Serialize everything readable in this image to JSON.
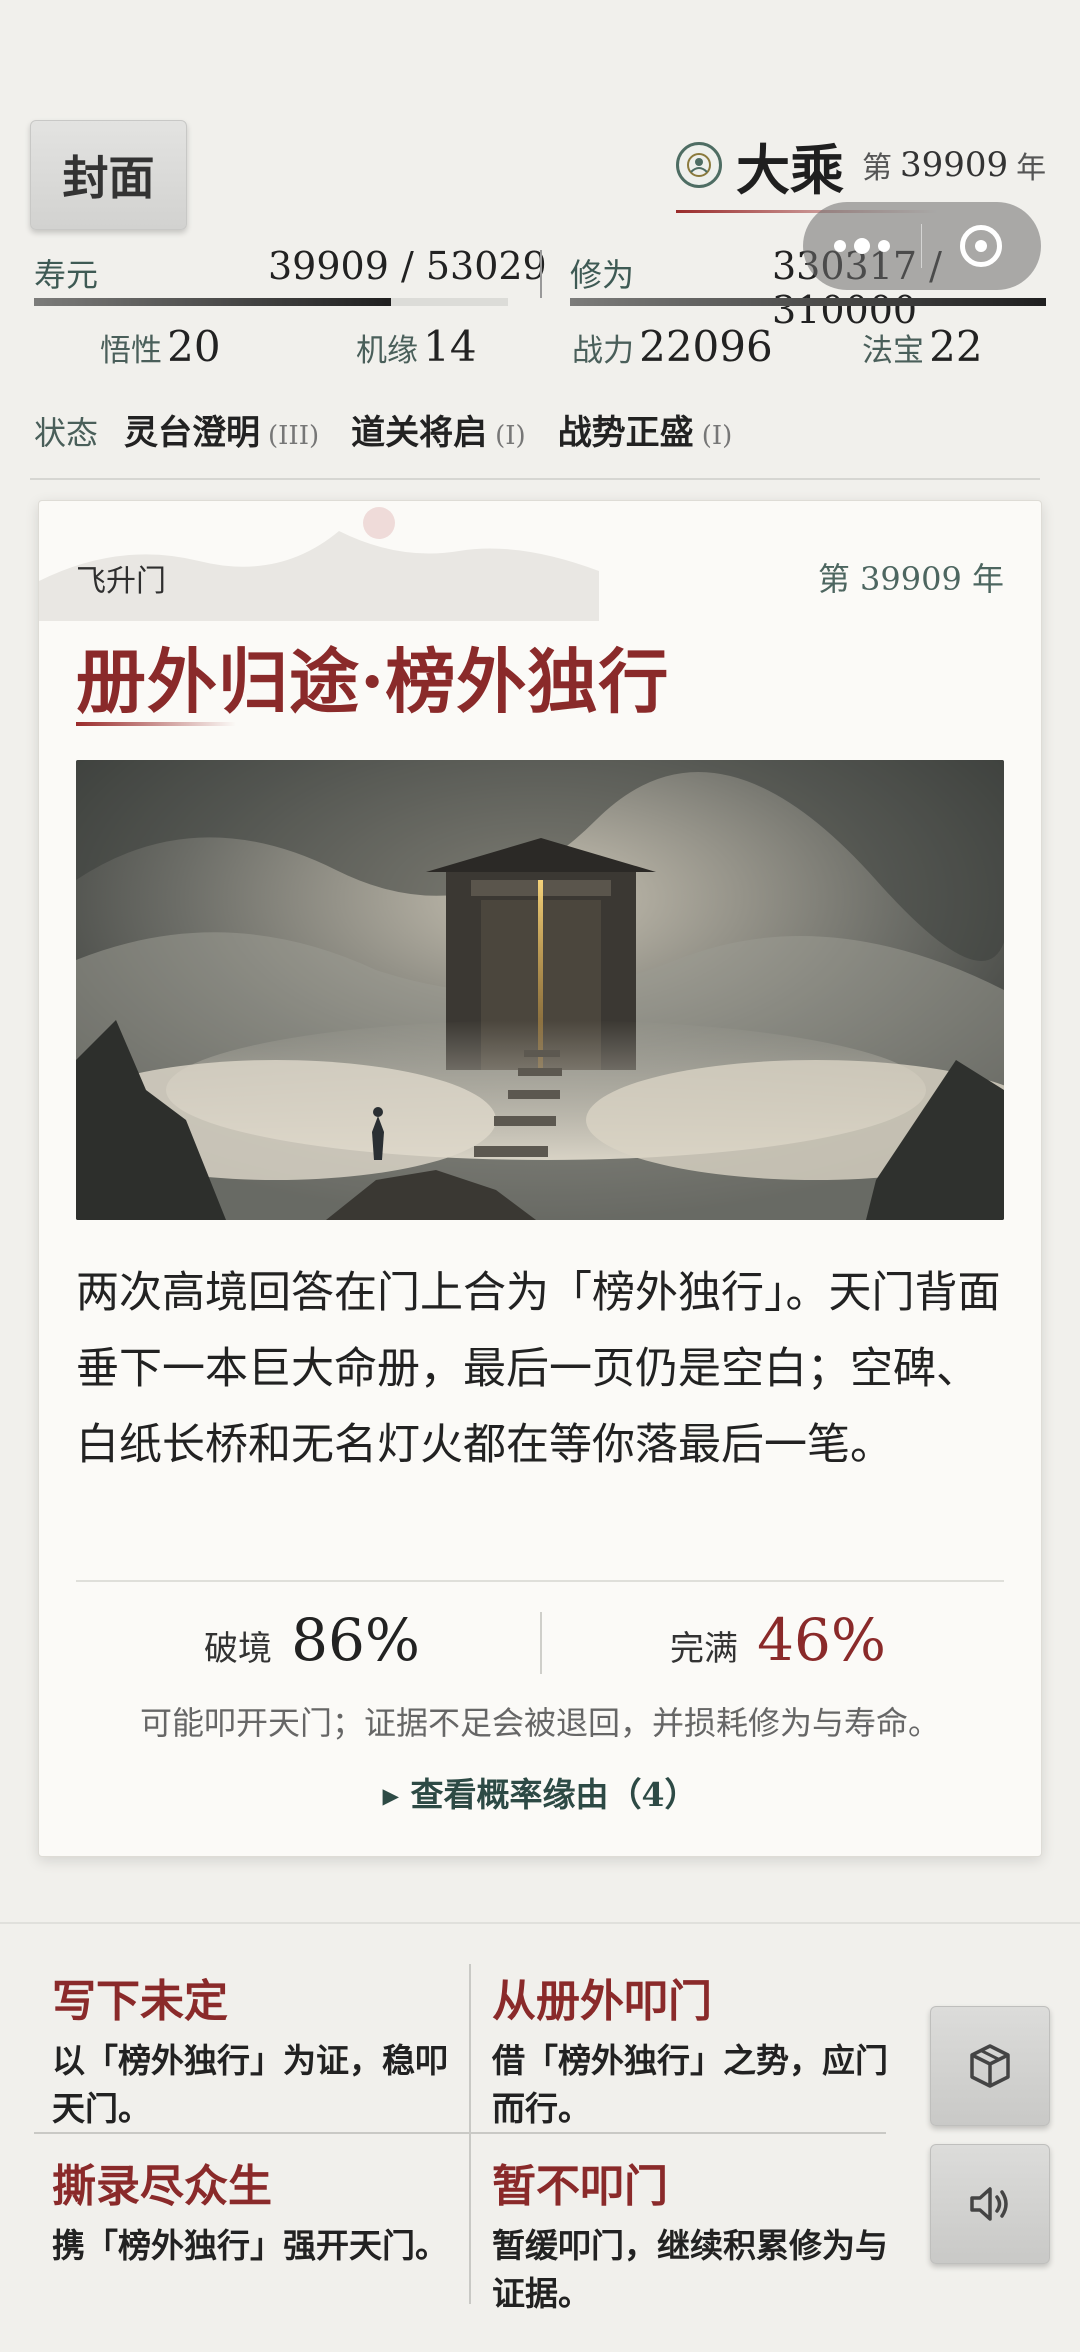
{
  "header": {
    "cover_label": "封面",
    "realm": "大乘",
    "year_label": "第",
    "year_value": "39909",
    "year_suffix": "年"
  },
  "stats": {
    "lifespan_label": "寿元",
    "lifespan_value": "39909 / 53029",
    "lifespan_ratio": 0.7526,
    "cultivation_label": "修为",
    "cultivation_value": "330317 / 310000",
    "cultivation_ratio": 1.0,
    "comprehension_label": "悟性",
    "comprehension_value": "20",
    "fortune_label": "机缘",
    "fortune_value": "14",
    "combat_label": "战力",
    "combat_value": "22096",
    "treasure_label": "法宝",
    "treasure_value": "22"
  },
  "status": {
    "label": "状态",
    "items": [
      {
        "name": "灵台澄明",
        "tier": "(III)"
      },
      {
        "name": "道关将启",
        "tier": "(I)"
      },
      {
        "name": "战势正盛",
        "tier": "(I)"
      }
    ]
  },
  "event": {
    "sect": "飞升门",
    "year": "第 39909 年",
    "title": "册外归途·榜外独行",
    "story": "两次高境回答在门上合为「榜外独行」。天门背面垂下一本巨大命册，最后一页仍是空白；空碑、白纸长桥和无名灯火都在等你落最后一笔。",
    "breakthrough_label": "破境",
    "breakthrough_value": "86%",
    "perfection_label": "完满",
    "perfection_value": "46%",
    "note": "可能叩开天门；证据不足会被退回，并损耗修为与寿命。",
    "reason_link": "▸ 查看概率缘由（4）"
  },
  "choices": [
    {
      "title": "写下未定",
      "desc": "以「榜外独行」为证，稳叩天门。"
    },
    {
      "title": "从册外叩门",
      "desc": "借「榜外独行」之势，应门而行。"
    },
    {
      "title": "撕录尽众生",
      "desc": "携「榜外独行」强开天门。"
    },
    {
      "title": "暂不叩门",
      "desc": "暂缓叩门，继续积累修为与证据。"
    }
  ],
  "side_buttons": {
    "top_icon": "box-icon",
    "bottom_icon": "speaker-icon"
  },
  "colors": {
    "accent_red": "#8a2a2a",
    "accent_teal": "#3e5a54",
    "background": "#f1f0ec"
  }
}
